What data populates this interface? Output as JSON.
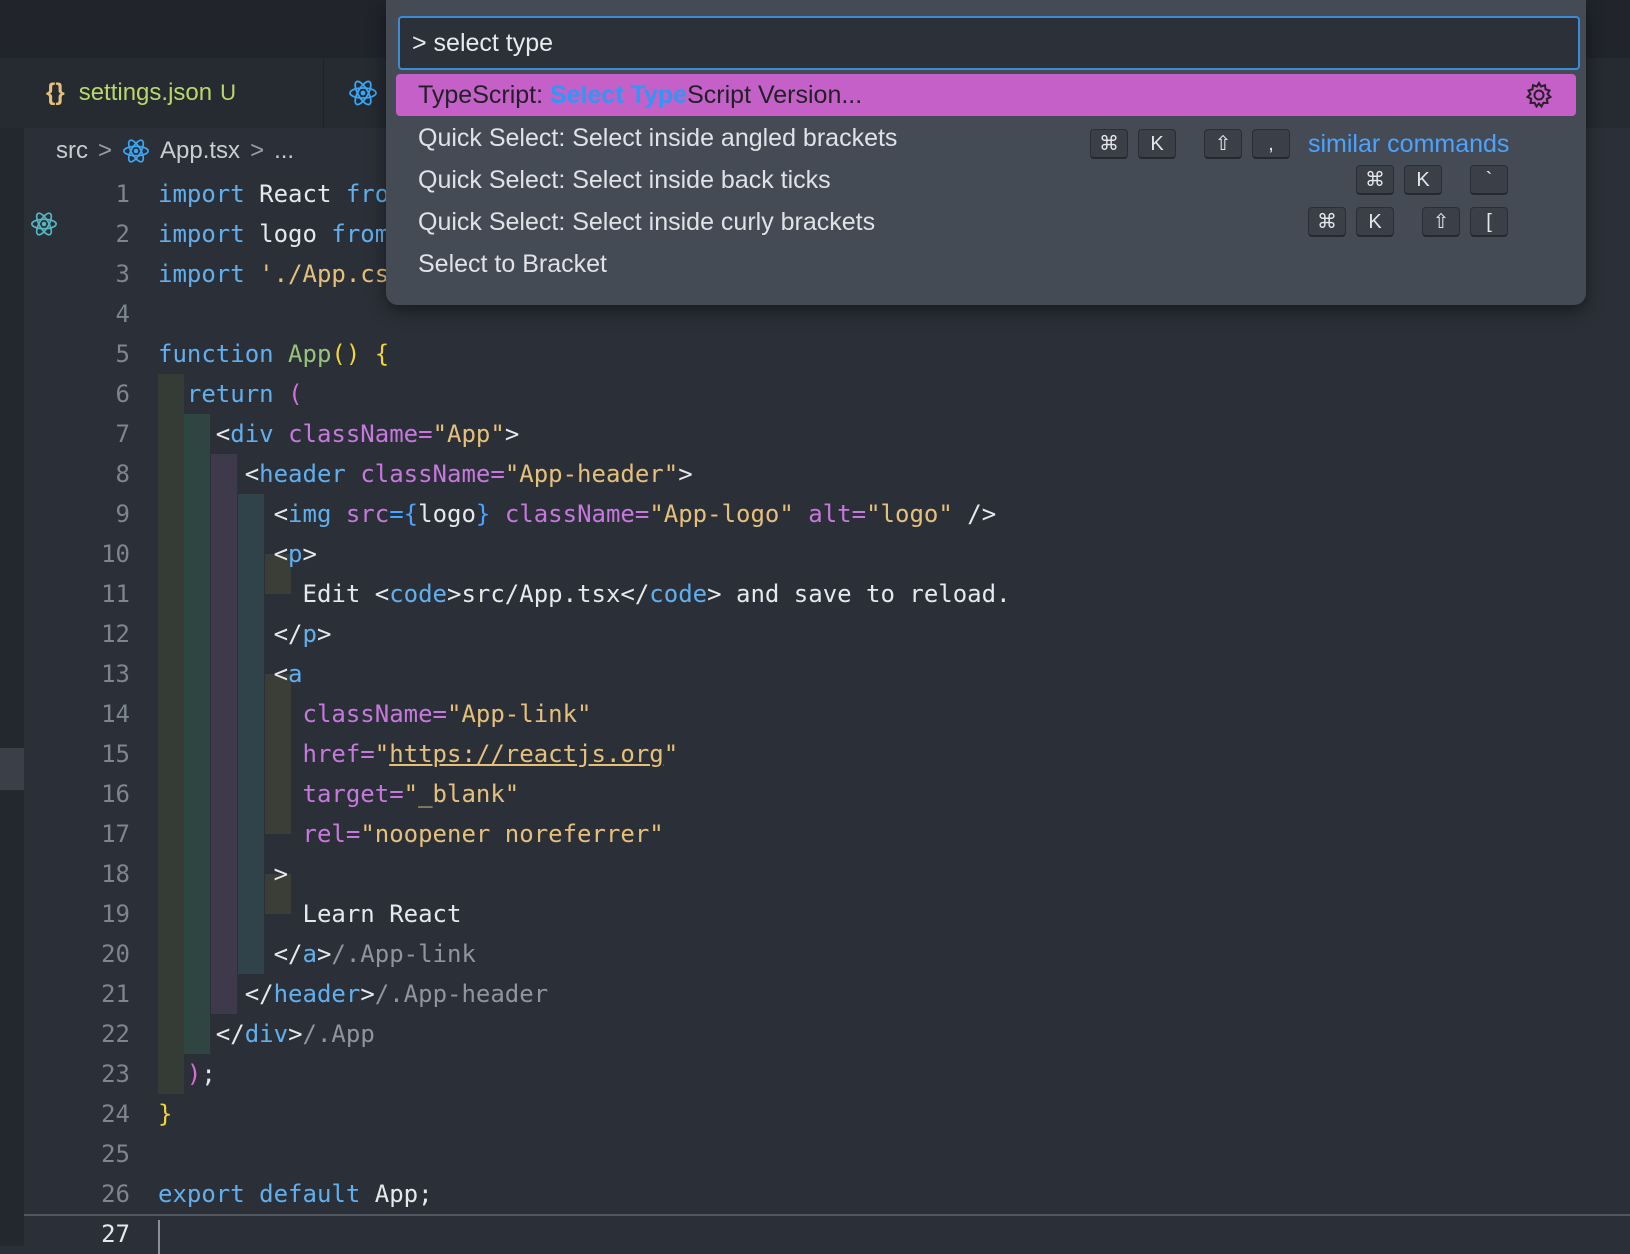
{
  "tabs": [
    {
      "icon": "braces-icon",
      "label": "settings.json",
      "modified": "U"
    },
    {
      "icon": "react-icon",
      "label": ""
    }
  ],
  "breadcrumb": [
    "src",
    "App.tsx",
    "..."
  ],
  "palette": {
    "query": "> select type",
    "items": [
      {
        "prefix": "TypeScript: ",
        "match": "Select Type",
        "suffix": "Script Version...",
        "keys": [],
        "action": "gear-icon"
      },
      {
        "label": "Quick Select: Select inside angled brackets",
        "keys": [
          "⌘",
          "K",
          "⇧",
          ","
        ],
        "extra": "similar commands"
      },
      {
        "label": "Quick Select: Select inside back ticks",
        "keys": [
          "⌘",
          "K",
          "`"
        ]
      },
      {
        "label": "Quick Select: Select inside curly brackets",
        "keys": [
          "⌘",
          "K",
          "⇧",
          "["
        ]
      },
      {
        "label": "Select to Bracket",
        "keys": []
      }
    ]
  },
  "editor": {
    "line_numbers": [
      "1",
      "2",
      "3",
      "4",
      "5",
      "6",
      "7",
      "8",
      "9",
      "10",
      "11",
      "12",
      "13",
      "14",
      "15",
      "16",
      "17",
      "18",
      "19",
      "20",
      "21",
      "22",
      "23",
      "24",
      "25",
      "26",
      "27"
    ],
    "active_line": "27",
    "lines": {
      "l1": [
        "import",
        "React",
        "fro"
      ],
      "l2": [
        "import",
        "logo",
        "from"
      ],
      "l3": [
        "import",
        "'./App.cs"
      ],
      "l5": [
        "function",
        "App",
        "()",
        "{"
      ],
      "l6": [
        "return",
        "("
      ],
      "l7": [
        "<",
        "div",
        "className",
        "=",
        "\"App\"",
        ">"
      ],
      "l8": [
        "<",
        "header",
        "className",
        "=",
        "\"App-header\"",
        ">"
      ],
      "l9": [
        "<",
        "img",
        "src",
        "={",
        "logo",
        "}",
        "className",
        "=",
        "\"App-logo\"",
        "alt",
        "=",
        "\"logo\"",
        " />"
      ],
      "l10": [
        "<",
        "p",
        ">"
      ],
      "l11": [
        "Edit ",
        "<",
        "code",
        ">src/App.tsx</",
        "code",
        "> and save to reload."
      ],
      "l12": [
        "</",
        "p",
        ">"
      ],
      "l13": [
        "<",
        "a"
      ],
      "l14": [
        "className",
        "=",
        "\"App-link\""
      ],
      "l15": [
        "href",
        "=",
        "\"",
        "https://reactjs.org",
        "\""
      ],
      "l16": [
        "target",
        "=",
        "\"_blank\""
      ],
      "l17": [
        "rel",
        "=",
        "\"noopener noreferrer\""
      ],
      "l18": [
        ">"
      ],
      "l19": [
        "Learn React"
      ],
      "l20": [
        "</",
        "a",
        ">",
        "/.App-link"
      ],
      "l21": [
        "</",
        "header",
        ">",
        "/.App-header"
      ],
      "l22": [
        "</",
        "div",
        ">",
        "/.App"
      ],
      "l23": [
        ")",
        ";"
      ],
      "l24": [
        "}"
      ],
      "l26": [
        "export",
        "default",
        "App;"
      ]
    }
  },
  "colors": {
    "selected_item_bg": "#c560c8",
    "match_highlight": "#2d98f5",
    "input_border": "#3b8bd6",
    "link": "#4ba3ff"
  }
}
